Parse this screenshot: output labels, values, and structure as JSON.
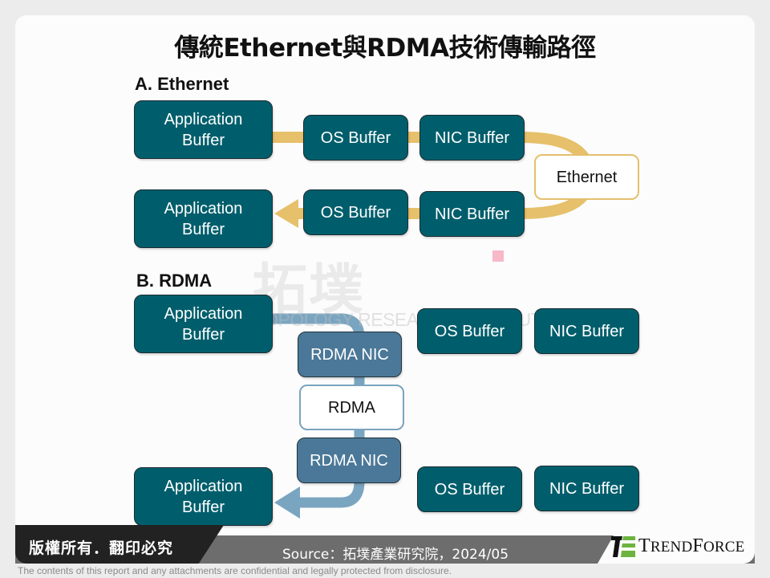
{
  "title": "傳統Ethernet與RDMA技術傳輸路徑",
  "section_a": {
    "label": "A. Ethernet",
    "top_row": {
      "app": "Application\nBuffer",
      "os": "OS Buffer",
      "nic": "NIC Buffer"
    },
    "bottom_row": {
      "app": "Application\nBuffer",
      "os": "OS Buffer",
      "nic": "NIC Buffer"
    },
    "link": "Ethernet",
    "path_color": "#e6c06a"
  },
  "section_b": {
    "label": "B. RDMA",
    "top_row": {
      "app": "Application\nBuffer",
      "os": "OS Buffer",
      "nic": "NIC Buffer",
      "rnic": "RDMA NIC"
    },
    "bottom_row": {
      "app": "Application\nBuffer",
      "os": "OS Buffer",
      "nic": "NIC Buffer",
      "rnic": "RDMA NIC"
    },
    "link": "RDMA",
    "path_color": "#7aa5c0"
  },
  "watermark": {
    "cn": "拓墣",
    "en": "TOPOLOGY RESEARCH INSTITUTE"
  },
  "footer": {
    "copyright": "版權所有．翻印必究",
    "source": "Source：拓墣產業研究院，2024/05",
    "logo_prefix": "T",
    "logo_rest_1": "REND",
    "logo_mid": "F",
    "logo_rest_2": "ORCE",
    "disclaimer": "The contents of this report and any attachments are confidential and legally protected from disclosure."
  },
  "colors": {
    "box_teal": "#005e6c",
    "box_rnic": "#4b7898",
    "logo_green": "#6cb33f"
  }
}
